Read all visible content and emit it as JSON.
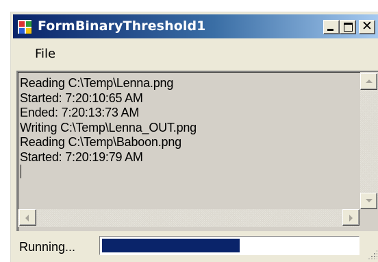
{
  "window": {
    "title": "FormBinaryThreshold1",
    "controls": [
      "minimize-icon",
      "maximize-icon",
      "close-icon"
    ],
    "close_glyph": "✕"
  },
  "menu": {
    "items": [
      {
        "label": "File"
      }
    ]
  },
  "log": {
    "lines": [
      "Reading C:\\Temp\\Lenna.png",
      "Started: 7:20:10:65 AM",
      "Ended: 7:20:13:73 AM",
      "Writing C:\\Temp\\Lenna_OUT.png",
      "Reading C:\\Temp\\Baboon.png",
      "Started: 7:20:19:79 AM"
    ]
  },
  "status": {
    "text": "Running...",
    "progress_fraction": 0.54
  },
  "colors": {
    "title_start": "#0a246a",
    "title_end": "#a6caf0",
    "progress_fill": "#0a246a",
    "face": "#ece9d8"
  }
}
